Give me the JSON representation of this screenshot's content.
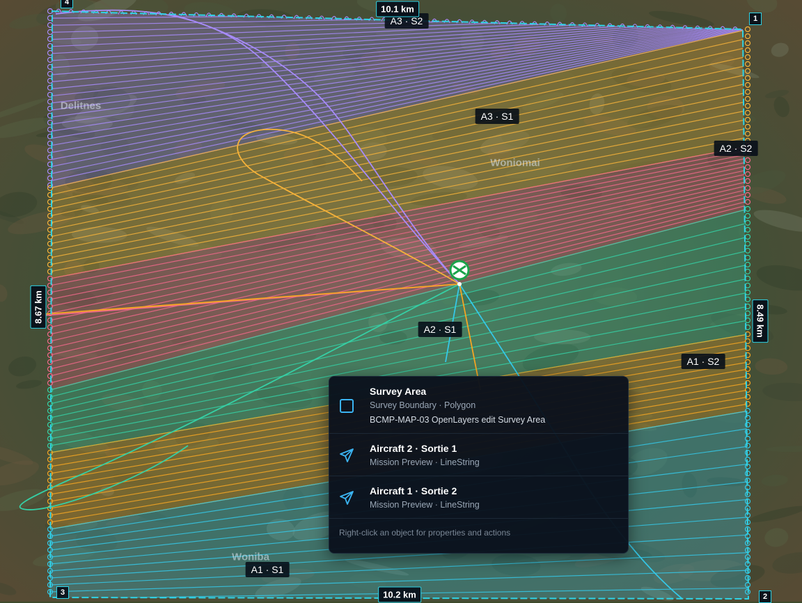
{
  "map": {
    "corners": [
      "1",
      "2",
      "3",
      "4"
    ],
    "distances": {
      "top": "10.1 km",
      "bottom": "10.2 km",
      "left": "8.67 km",
      "right": "8.49 km"
    },
    "place_names": [
      "Delitnes",
      "Woniomai",
      "Woniba"
    ],
    "sortie_labels": [
      {
        "id": "a3s2",
        "text": "A3 · S2",
        "color": "#a78bfa"
      },
      {
        "id": "a3s1",
        "text": "A3 · S1",
        "color": "#f5b23a"
      },
      {
        "id": "a2s2",
        "text": "A2 · S2",
        "color": "#f0688a"
      },
      {
        "id": "a2s1",
        "text": "A2 · S1",
        "color": "#35d0a5"
      },
      {
        "id": "a1s2",
        "text": "A1 · S2",
        "color": "#f5a623"
      },
      {
        "id": "a1s1",
        "text": "A1 · S1",
        "color": "#35c8e8"
      }
    ],
    "boundary_color": "#2fd3e6"
  },
  "popup": {
    "items": [
      {
        "title": "Survey Area",
        "sub": "Survey Boundary · Polygon",
        "sub2": "BCMP-MAP-03 OpenLayers edit Survey Area",
        "icon": "square-icon"
      },
      {
        "title": "Aircraft 2 · Sortie 1",
        "sub": "Mission Preview · LineString",
        "icon": "paper-plane-icon"
      },
      {
        "title": "Aircraft 1 · Sortie 2",
        "sub": "Mission Preview · LineString",
        "icon": "paper-plane-icon"
      }
    ],
    "hint": "Right-click an object for properties and actions"
  }
}
